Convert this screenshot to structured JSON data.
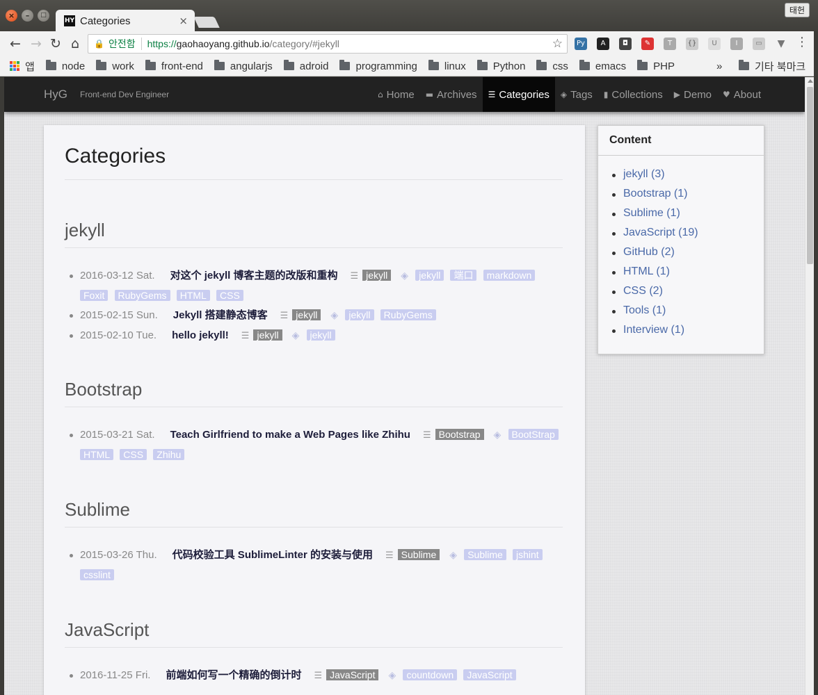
{
  "browser": {
    "tab_title": "Categories",
    "tab_favicon": "HY",
    "tab_close": "×",
    "ime_label": "태헌",
    "secure_label": "안전함",
    "url_scheme": "https://",
    "url_host": "gaohaoyang.github.io",
    "url_path": "/category/#jekyll",
    "bookmarks": {
      "apps": "앱",
      "items": [
        "node",
        "work",
        "front-end",
        "angularjs",
        "adroid",
        "programming",
        "linux",
        "Python",
        "css",
        "emacs",
        "PHP"
      ],
      "more": "»",
      "other": "기타 북마크"
    }
  },
  "site": {
    "brand": "HyG",
    "tagline": "Front-end Dev Engineer",
    "nav": [
      {
        "icon": "home-icon",
        "glyph": "⌂",
        "label": "Home",
        "active": false
      },
      {
        "icon": "archive-icon",
        "glyph": "▬",
        "label": "Archives",
        "active": false
      },
      {
        "icon": "list-icon",
        "glyph": "☰",
        "label": "Categories",
        "active": true
      },
      {
        "icon": "tags-icon",
        "glyph": "◈",
        "label": "Tags",
        "active": false
      },
      {
        "icon": "bookmark-icon",
        "glyph": "▮",
        "label": "Collections",
        "active": false
      },
      {
        "icon": "play-icon",
        "glyph": "▶",
        "label": "Demo",
        "active": false
      },
      {
        "icon": "heart-icon",
        "glyph": "♥",
        "label": "About",
        "active": false
      }
    ]
  },
  "main": {
    "title": "Categories",
    "categories": [
      {
        "name": "jekyll",
        "posts": [
          {
            "date": "2016-03-12 Sat.",
            "title": "对这个 jekyll 博客主题的改版和重构",
            "category": "jekyll",
            "tags": [
              "jekyll",
              "端口",
              "markdown",
              "Foxit",
              "RubyGems",
              "HTML",
              "CSS"
            ]
          },
          {
            "date": "2015-02-15 Sun.",
            "title": "Jekyll 搭建静态博客",
            "category": "jekyll",
            "tags": [
              "jekyll",
              "RubyGems"
            ]
          },
          {
            "date": "2015-02-10 Tue.",
            "title": "hello jekyll!",
            "category": "jekyll",
            "tags": [
              "jekyll"
            ]
          }
        ]
      },
      {
        "name": "Bootstrap",
        "posts": [
          {
            "date": "2015-03-21 Sat.",
            "title": "Teach Girlfriend to make a Web Pages like Zhihu",
            "category": "Bootstrap",
            "tags": [
              "BootStrap",
              "HTML",
              "CSS",
              "Zhihu"
            ]
          }
        ]
      },
      {
        "name": "Sublime",
        "posts": [
          {
            "date": "2015-03-26 Thu.",
            "title": "代码校验工具 SublimeLinter 的安装与使用",
            "category": "Sublime",
            "tags": [
              "Sublime",
              "jshint",
              "csslint"
            ]
          }
        ]
      },
      {
        "name": "JavaScript",
        "posts": [
          {
            "date": "2016-11-25 Fri.",
            "title": "前端如何写一个精确的倒计时",
            "category": "JavaScript",
            "tags": [
              "countdown",
              "JavaScript"
            ]
          }
        ]
      }
    ]
  },
  "sidebar": {
    "heading": "Content",
    "items": [
      "jekyll (3)",
      "Bootstrap (1)",
      "Sublime (1)",
      "JavaScript (19)",
      "GitHub (2)",
      "HTML (1)",
      "CSS (2)",
      "Tools (1)",
      "Interview (1)"
    ]
  }
}
